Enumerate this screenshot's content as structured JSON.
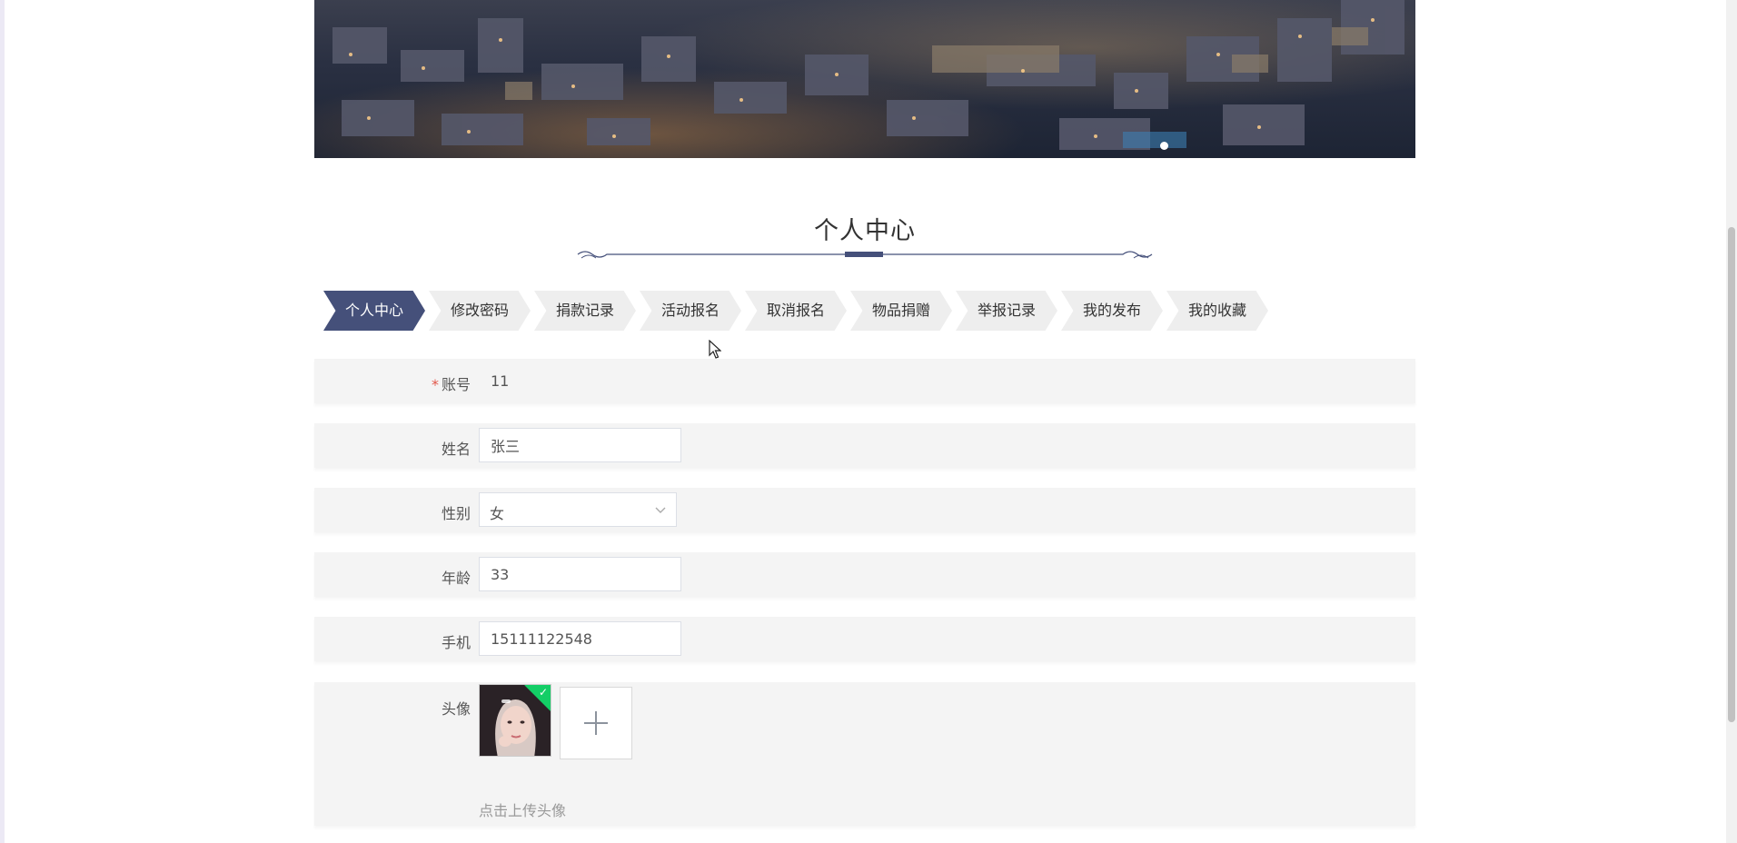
{
  "section": {
    "title": "个人中心"
  },
  "tabs": [
    {
      "label": "个人中心",
      "active": true
    },
    {
      "label": "修改密码",
      "active": false
    },
    {
      "label": "捐款记录",
      "active": false
    },
    {
      "label": "活动报名",
      "active": false
    },
    {
      "label": "取消报名",
      "active": false
    },
    {
      "label": "物品捐赠",
      "active": false
    },
    {
      "label": "举报记录",
      "active": false
    },
    {
      "label": "我的发布",
      "active": false
    },
    {
      "label": "我的收藏",
      "active": false
    }
  ],
  "form": {
    "account": {
      "label": "账号",
      "required_mark": "*",
      "value": "11"
    },
    "name": {
      "label": "姓名",
      "value": "张三"
    },
    "gender": {
      "label": "性别",
      "value": "女"
    },
    "age": {
      "label": "年龄",
      "value": "33"
    },
    "phone": {
      "label": "手机",
      "value": "15111122548"
    },
    "avatar": {
      "label": "头像",
      "upload_hint": "点击上传头像"
    }
  },
  "colors": {
    "accent": "#45507a",
    "tab_inactive": "#eeeeee",
    "row_background": "#f4f4f4",
    "required": "#e2574a",
    "success_badge": "#13ce66"
  },
  "icons": {
    "chevron": "chevron-down-icon",
    "upload": "plus-icon",
    "cursor": "mouse-pointer-icon",
    "check": "check-icon"
  }
}
